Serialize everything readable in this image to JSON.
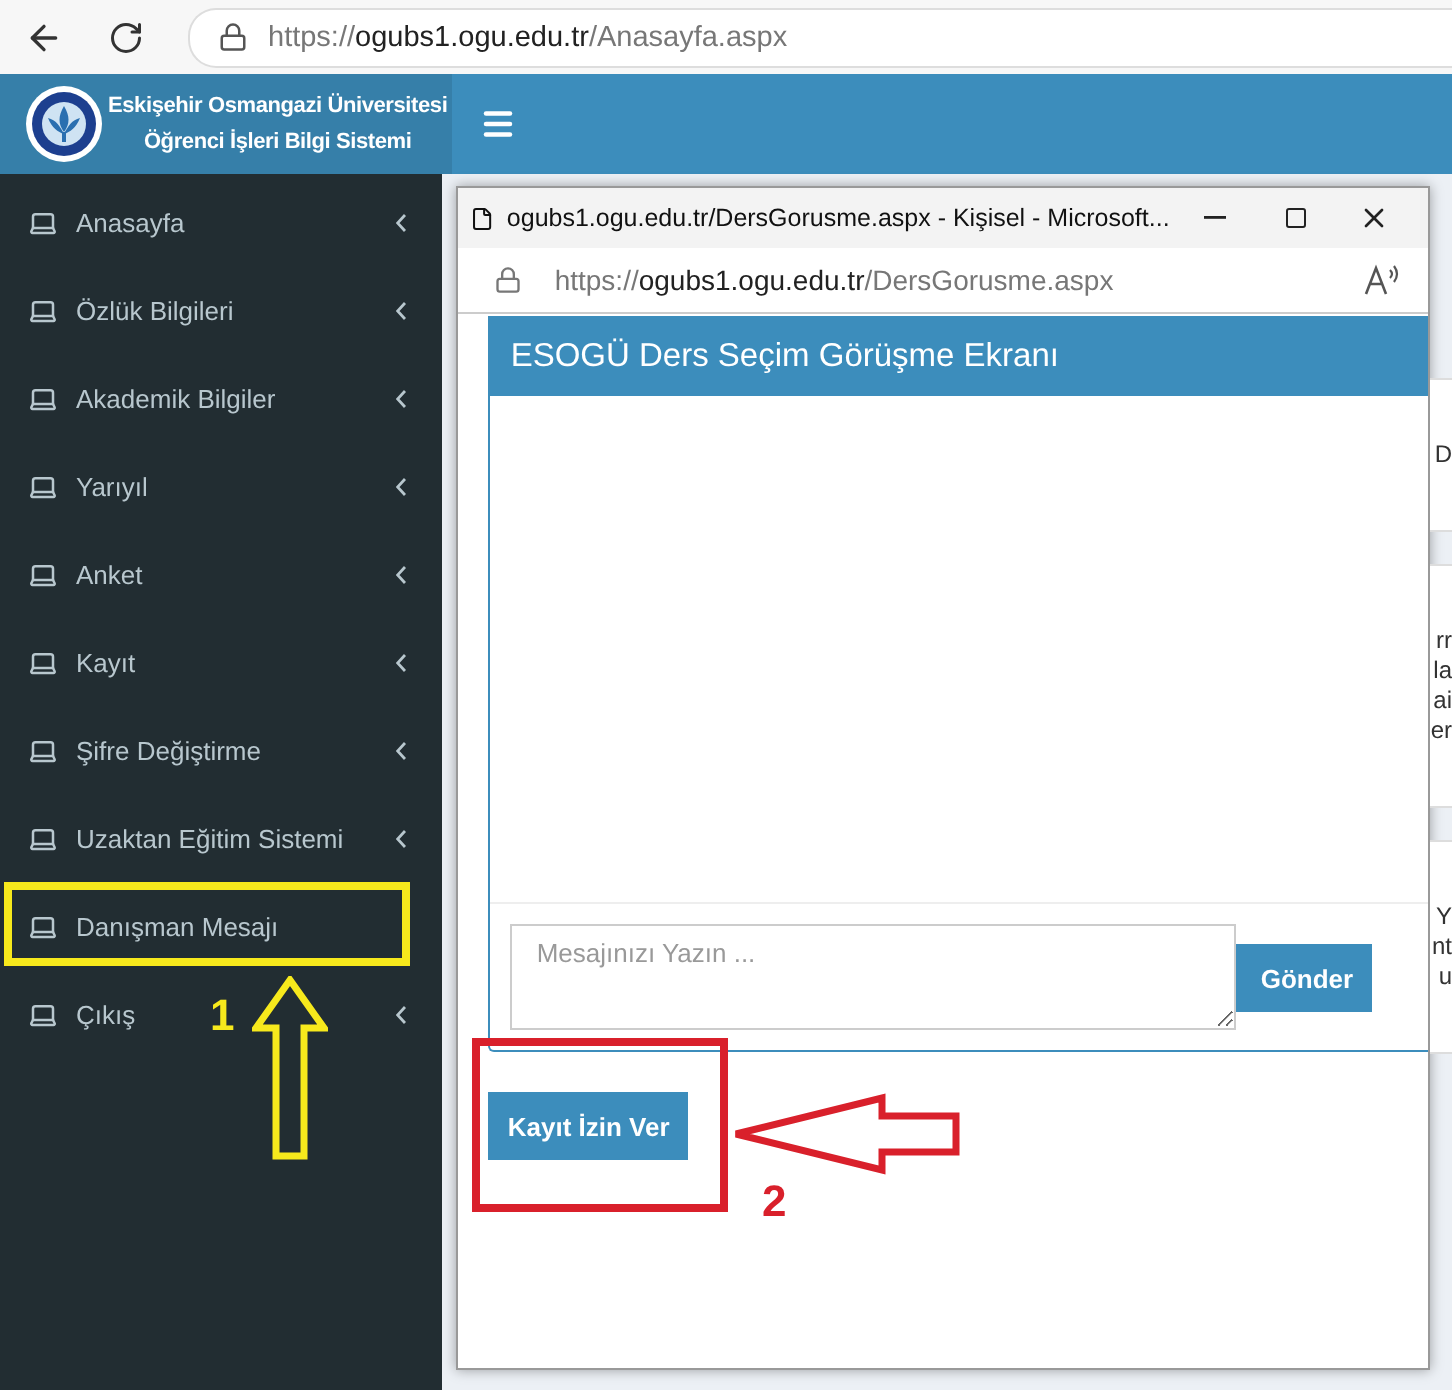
{
  "browser": {
    "url_scheme": "https://",
    "url_host": "ogubs1.ogu.edu.tr",
    "url_path": "/Anasayfa.aspx"
  },
  "header": {
    "title_line_1": "Eskişehir Osmangazi Üniversitesi",
    "title_line_2": "Öğrenci İşleri Bilgi Sistemi"
  },
  "sidebar": {
    "items": [
      {
        "label": "Anasayfa",
        "has_caret": true
      },
      {
        "label": "Özlük Bilgileri",
        "has_caret": true
      },
      {
        "label": "Akademik Bilgiler",
        "has_caret": true
      },
      {
        "label": "Yarıyıl",
        "has_caret": true
      },
      {
        "label": "Anket",
        "has_caret": true
      },
      {
        "label": "Kayıt",
        "has_caret": true
      },
      {
        "label": "Şifre Değiştirme",
        "has_caret": true
      },
      {
        "label": "Uzaktan Eğitim Sistemi",
        "has_caret": true
      },
      {
        "label": "Danışman Mesajı",
        "has_caret": false
      },
      {
        "label": "Çıkış",
        "has_caret": true
      }
    ]
  },
  "popup": {
    "window_title": "ogubs1.ogu.edu.tr/DersGorusme.aspx - Kişisel - Microsoft...",
    "url_scheme": "https://",
    "url_host": "ogubs1.ogu.edu.tr",
    "url_path": "/DersGorusme.aspx",
    "panel_title": "ESOGÜ Ders Seçim Görüşme Ekranı",
    "message_placeholder": "Mesajınızı Yazın ...",
    "send_button": "Gönder",
    "approve_button": "Kayıt İzin Ver"
  },
  "background_fragments": [
    {
      "lines": [
        "D"
      ]
    },
    {
      "lines": [
        "rr",
        "la",
        "ai",
        "er"
      ]
    },
    {
      "lines": [
        "Y",
        "nt",
        "u"
      ]
    }
  ],
  "annotations": [
    {
      "label": "1",
      "color": "#f7e91c"
    },
    {
      "label": "2",
      "color": "#d9202b"
    }
  ]
}
